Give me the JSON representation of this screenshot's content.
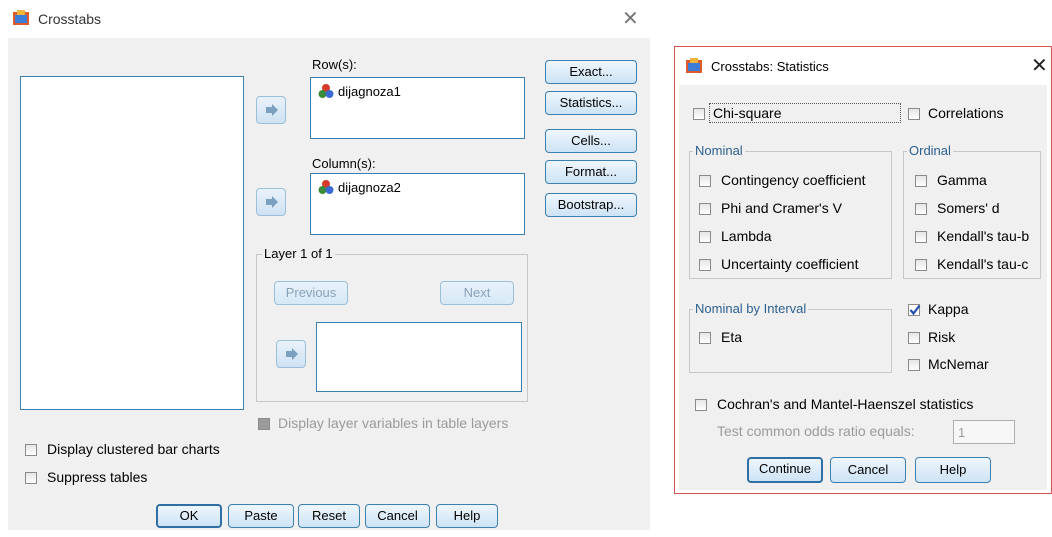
{
  "crosstabs": {
    "title": "Crosstabs",
    "close_glyph": "✕",
    "rows_label": "Row(s):",
    "rows_item": "dijagnoza1",
    "columns_label": "Column(s):",
    "columns_item": "dijagnoza2",
    "layer_label": "Layer 1 of 1",
    "previous": "Previous",
    "next": "Next",
    "display_layer": "Display layer variables in table layers",
    "display_clustered": "Display clustered bar charts",
    "suppress_tables": "Suppress tables",
    "side_buttons": [
      "Exact...",
      "Statistics...",
      "Cells...",
      "Format...",
      "Bootstrap..."
    ],
    "bottom_buttons": [
      "OK",
      "Paste",
      "Reset",
      "Cancel",
      "Help"
    ]
  },
  "statistics": {
    "title": "Crosstabs: Statistics",
    "close_glyph": "✕",
    "chi_square": "Chi-square",
    "correlations": "Correlations",
    "nominal_label": "Nominal",
    "nominal_items": [
      "Contingency coefficient",
      "Phi and Cramer's V",
      "Lambda",
      "Uncertainty coefficient"
    ],
    "ordinal_label": "Ordinal",
    "ordinal_items": [
      "Gamma",
      "Somers' d",
      "Kendall's tau-b",
      "Kendall's tau-c"
    ],
    "nominal_interval_label": "Nominal by Interval",
    "eta": "Eta",
    "kappa": "Kappa",
    "kappa_checked": true,
    "risk": "Risk",
    "mcnemar": "McNemar",
    "cochran": "Cochran's and Mantel-Haenszel statistics",
    "odds_label": "Test common odds ratio equals:",
    "odds_value": "1",
    "buttons": [
      "Continue",
      "Cancel",
      "Help"
    ]
  },
  "colors": {
    "accent_border": "#3c7fb1",
    "dialog_bg": "#f0f0f0",
    "stats_frame": "#d9534f"
  }
}
